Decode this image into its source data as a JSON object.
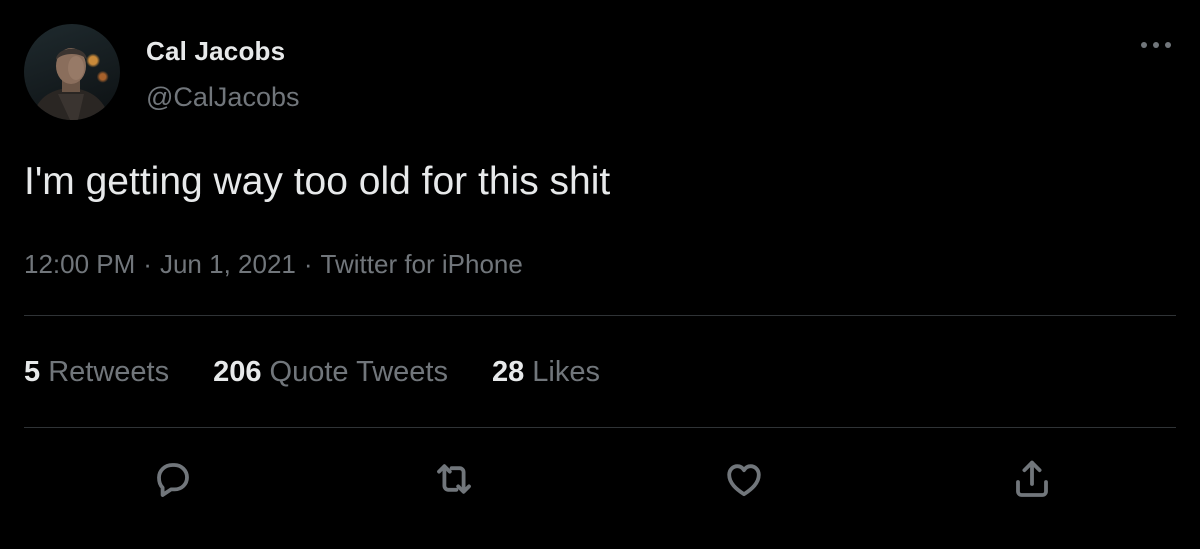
{
  "user": {
    "display_name": "Cal Jacobs",
    "handle": "@CalJacobs"
  },
  "tweet": {
    "text": "I'm getting way too old for this shit",
    "time": "12:00 PM",
    "date": "Jun 1, 2021",
    "source": "Twitter for iPhone",
    "separator": "·"
  },
  "stats": {
    "retweets": {
      "count": "5",
      "label": "Retweets"
    },
    "quotes": {
      "count": "206",
      "label": "Quote Tweets"
    },
    "likes": {
      "count": "28",
      "label": "Likes"
    }
  },
  "actions": [
    "reply-icon",
    "retweet-icon",
    "like-icon",
    "share-icon"
  ],
  "colors": {
    "background": "#000000",
    "primary_text": "#e7e9ea",
    "secondary_text": "#71767b",
    "divider": "#2f3336"
  }
}
